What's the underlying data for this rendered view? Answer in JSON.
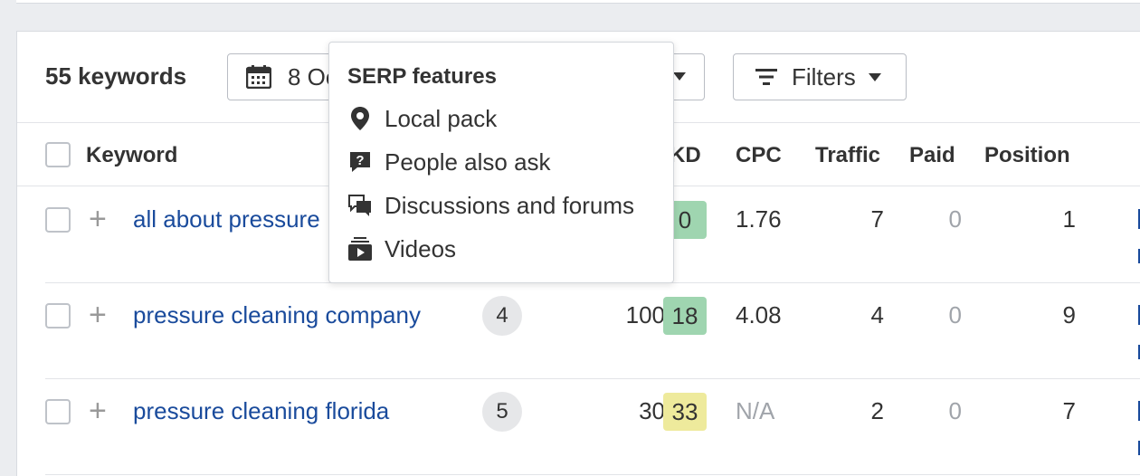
{
  "toolbar": {
    "keyword_count": "55 keywords",
    "date_label": "8 Oc",
    "filters_label": "Filters"
  },
  "table": {
    "headers": {
      "keyword": "Keyword",
      "kd": "KD",
      "cpc": "CPC",
      "traffic": "Traffic",
      "paid": "Paid",
      "position": "Position"
    },
    "rows": [
      {
        "keyword": "all about pressure",
        "badge": "",
        "volume": "",
        "kd": "0",
        "kd_color": "#9fd5b0",
        "cpc": "1.76",
        "traffic": "7",
        "paid": "0",
        "position": "1"
      },
      {
        "keyword": "pressure cleaning company",
        "badge": "4",
        "volume": "100",
        "kd": "18",
        "kd_color": "#9fd5b0",
        "cpc": "4.08",
        "traffic": "4",
        "paid": "0",
        "position": "9"
      },
      {
        "keyword": "pressure cleaning florida",
        "badge": "5",
        "volume": "30",
        "kd": "33",
        "kd_color": "#eeea9c",
        "cpc": "N/A",
        "traffic": "2",
        "paid": "0",
        "position": "7"
      }
    ]
  },
  "serp_dropdown": {
    "title": "SERP features",
    "items": [
      {
        "label": "Local pack",
        "icon": "map-pin-icon"
      },
      {
        "label": "People also ask",
        "icon": "question-bubble-icon"
      },
      {
        "label": "Discussions and forums",
        "icon": "chat-bubbles-icon"
      },
      {
        "label": "Videos",
        "icon": "video-stack-icon"
      }
    ]
  },
  "colors": {
    "link": "#1a4b9c",
    "kd_easy": "#9fd5b0",
    "kd_medium": "#eeea9c"
  }
}
